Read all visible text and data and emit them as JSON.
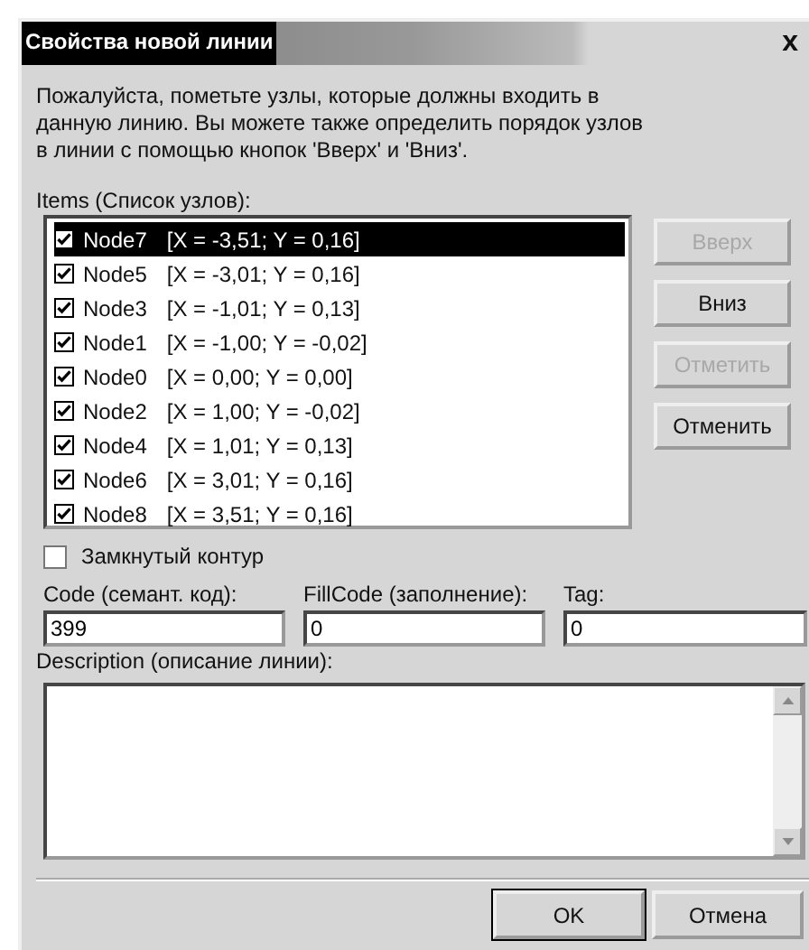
{
  "window": {
    "title": "Свойства новой линии",
    "close": "x"
  },
  "instructions": "Пожалуйста, пометьте узлы, которые должны входить в данную линию. Вы можете также определить порядок узлов в линии с помощью кнопок 'Вверх' и 'Вниз'.",
  "items_label": "Items (Список узлов):",
  "items": [
    {
      "name": "Node7",
      "coords": "[X = -3,51; Y = 0,16]",
      "checked": true,
      "selected": true
    },
    {
      "name": "Node5",
      "coords": "[X = -3,01; Y = 0,16]",
      "checked": true,
      "selected": false
    },
    {
      "name": "Node3",
      "coords": "[X = -1,01; Y = 0,13]",
      "checked": true,
      "selected": false
    },
    {
      "name": "Node1",
      "coords": "[X = -1,00; Y = -0,02]",
      "checked": true,
      "selected": false
    },
    {
      "name": "Node0",
      "coords": "[X = 0,00; Y = 0,00]",
      "checked": true,
      "selected": false
    },
    {
      "name": "Node2",
      "coords": "[X = 1,00; Y = -0,02]",
      "checked": true,
      "selected": false
    },
    {
      "name": "Node4",
      "coords": "[X = 1,01; Y = 0,13]",
      "checked": true,
      "selected": false
    },
    {
      "name": "Node6",
      "coords": "[X = 3,01; Y = 0,16]",
      "checked": true,
      "selected": false
    },
    {
      "name": "Node8",
      "coords": "[X = 3,51; Y = 0,16]",
      "checked": true,
      "selected": false
    }
  ],
  "side_buttons": [
    {
      "label": "Вверх",
      "disabled": true
    },
    {
      "label": "Вниз",
      "disabled": false
    },
    {
      "label": "Отметить",
      "disabled": true
    },
    {
      "label": "Отменить",
      "disabled": false
    }
  ],
  "closed_contour": {
    "label": "Замкнутый контур",
    "checked": false
  },
  "fields": [
    {
      "label": "Code (семант. код):",
      "value": "399"
    },
    {
      "label": "FillCode (заполнение):",
      "value": "0"
    },
    {
      "label": "Tag:",
      "value": "0"
    }
  ],
  "description": {
    "label": "Description (описание линии):"
  },
  "buttons": [
    {
      "label": "OK",
      "default": true
    },
    {
      "label": "Отмена",
      "default": false
    }
  ]
}
